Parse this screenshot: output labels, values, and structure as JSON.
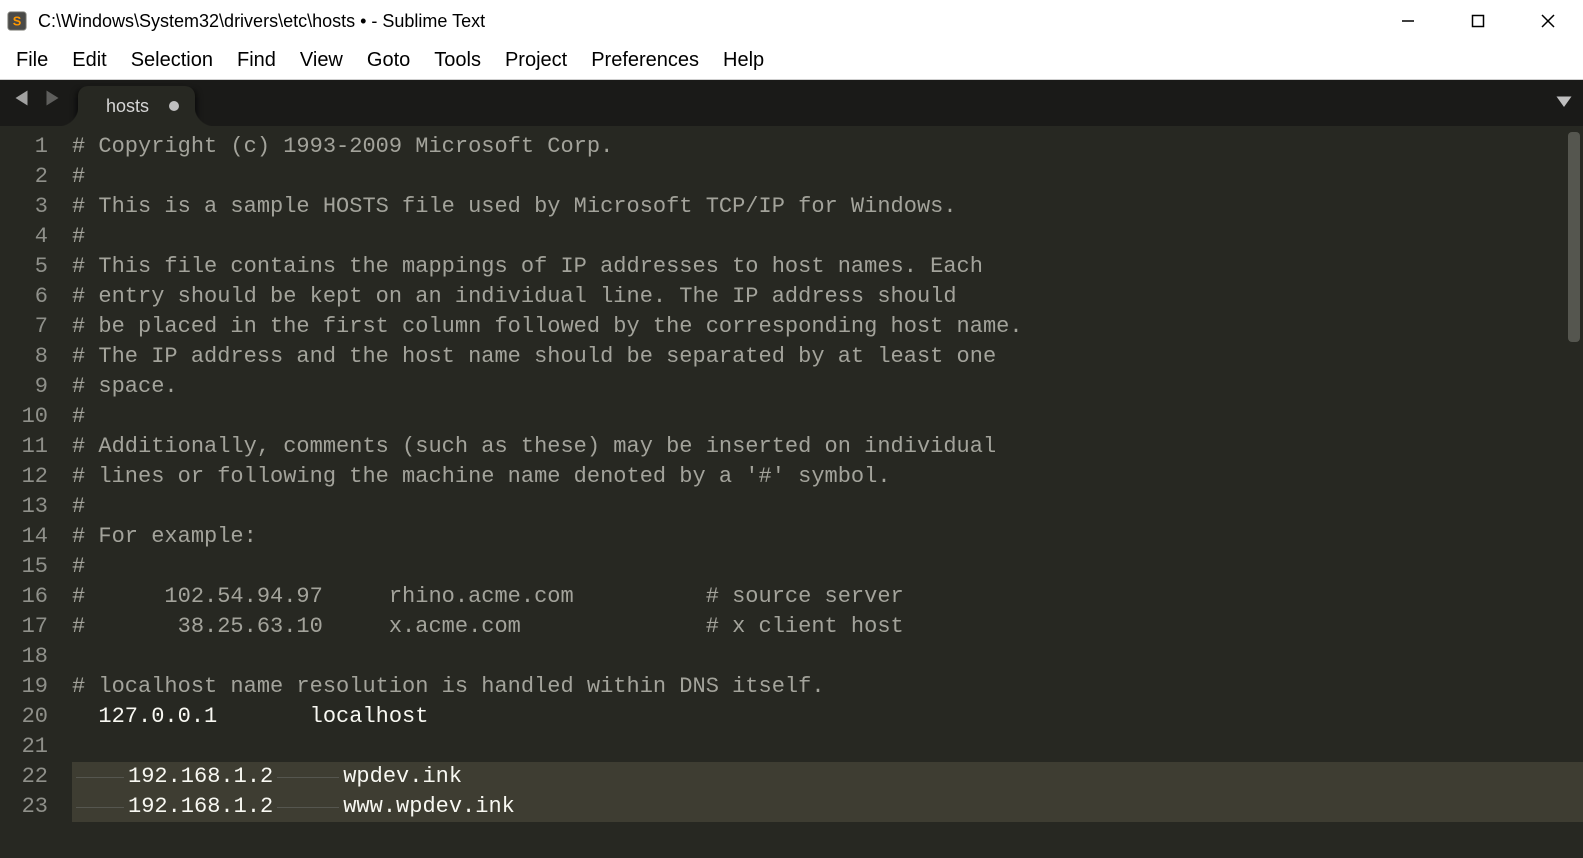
{
  "window": {
    "title": "C:\\Windows\\System32\\drivers\\etc\\hosts • - Sublime Text"
  },
  "menubar": {
    "items": [
      "File",
      "Edit",
      "Selection",
      "Find",
      "View",
      "Goto",
      "Tools",
      "Project",
      "Preferences",
      "Help"
    ]
  },
  "tabs": {
    "active": {
      "label": "hosts",
      "dirty": true
    }
  },
  "editor": {
    "highlighted_lines": [
      22,
      23
    ],
    "lines": [
      {
        "n": 1,
        "type": "comment",
        "text": "# Copyright (c) 1993-2009 Microsoft Corp."
      },
      {
        "n": 2,
        "type": "comment",
        "text": "#"
      },
      {
        "n": 3,
        "type": "comment",
        "text": "# This is a sample HOSTS file used by Microsoft TCP/IP for Windows."
      },
      {
        "n": 4,
        "type": "comment",
        "text": "#"
      },
      {
        "n": 5,
        "type": "comment",
        "text": "# This file contains the mappings of IP addresses to host names. Each"
      },
      {
        "n": 6,
        "type": "comment",
        "text": "# entry should be kept on an individual line. The IP address should"
      },
      {
        "n": 7,
        "type": "comment",
        "text": "# be placed in the first column followed by the corresponding host name."
      },
      {
        "n": 8,
        "type": "comment",
        "text": "# The IP address and the host name should be separated by at least one"
      },
      {
        "n": 9,
        "type": "comment",
        "text": "# space."
      },
      {
        "n": 10,
        "type": "comment",
        "text": "#"
      },
      {
        "n": 11,
        "type": "comment",
        "text": "# Additionally, comments (such as these) may be inserted on individual"
      },
      {
        "n": 12,
        "type": "comment",
        "text": "# lines or following the machine name denoted by a '#' symbol."
      },
      {
        "n": 13,
        "type": "comment",
        "text": "#"
      },
      {
        "n": 14,
        "type": "comment",
        "text": "# For example:"
      },
      {
        "n": 15,
        "type": "comment",
        "text": "#"
      },
      {
        "n": 16,
        "type": "comment",
        "text": "#      102.54.94.97     rhino.acme.com          # source server"
      },
      {
        "n": 17,
        "type": "comment",
        "text": "#       38.25.63.10     x.acme.com              # x client host"
      },
      {
        "n": 18,
        "type": "plain",
        "text": ""
      },
      {
        "n": 19,
        "type": "comment",
        "text": "# localhost name resolution is handled within DNS itself."
      },
      {
        "n": 20,
        "type": "plain",
        "text": "  127.0.0.1       localhost"
      },
      {
        "n": 21,
        "type": "plain",
        "text": ""
      },
      {
        "n": 22,
        "type": "plain",
        "tabbed": true,
        "col1": "192.168.1.2",
        "col2": "wpdev.ink"
      },
      {
        "n": 23,
        "type": "plain",
        "tabbed": true,
        "col1": "192.168.1.2",
        "col2": "www.wpdev.ink"
      }
    ]
  }
}
